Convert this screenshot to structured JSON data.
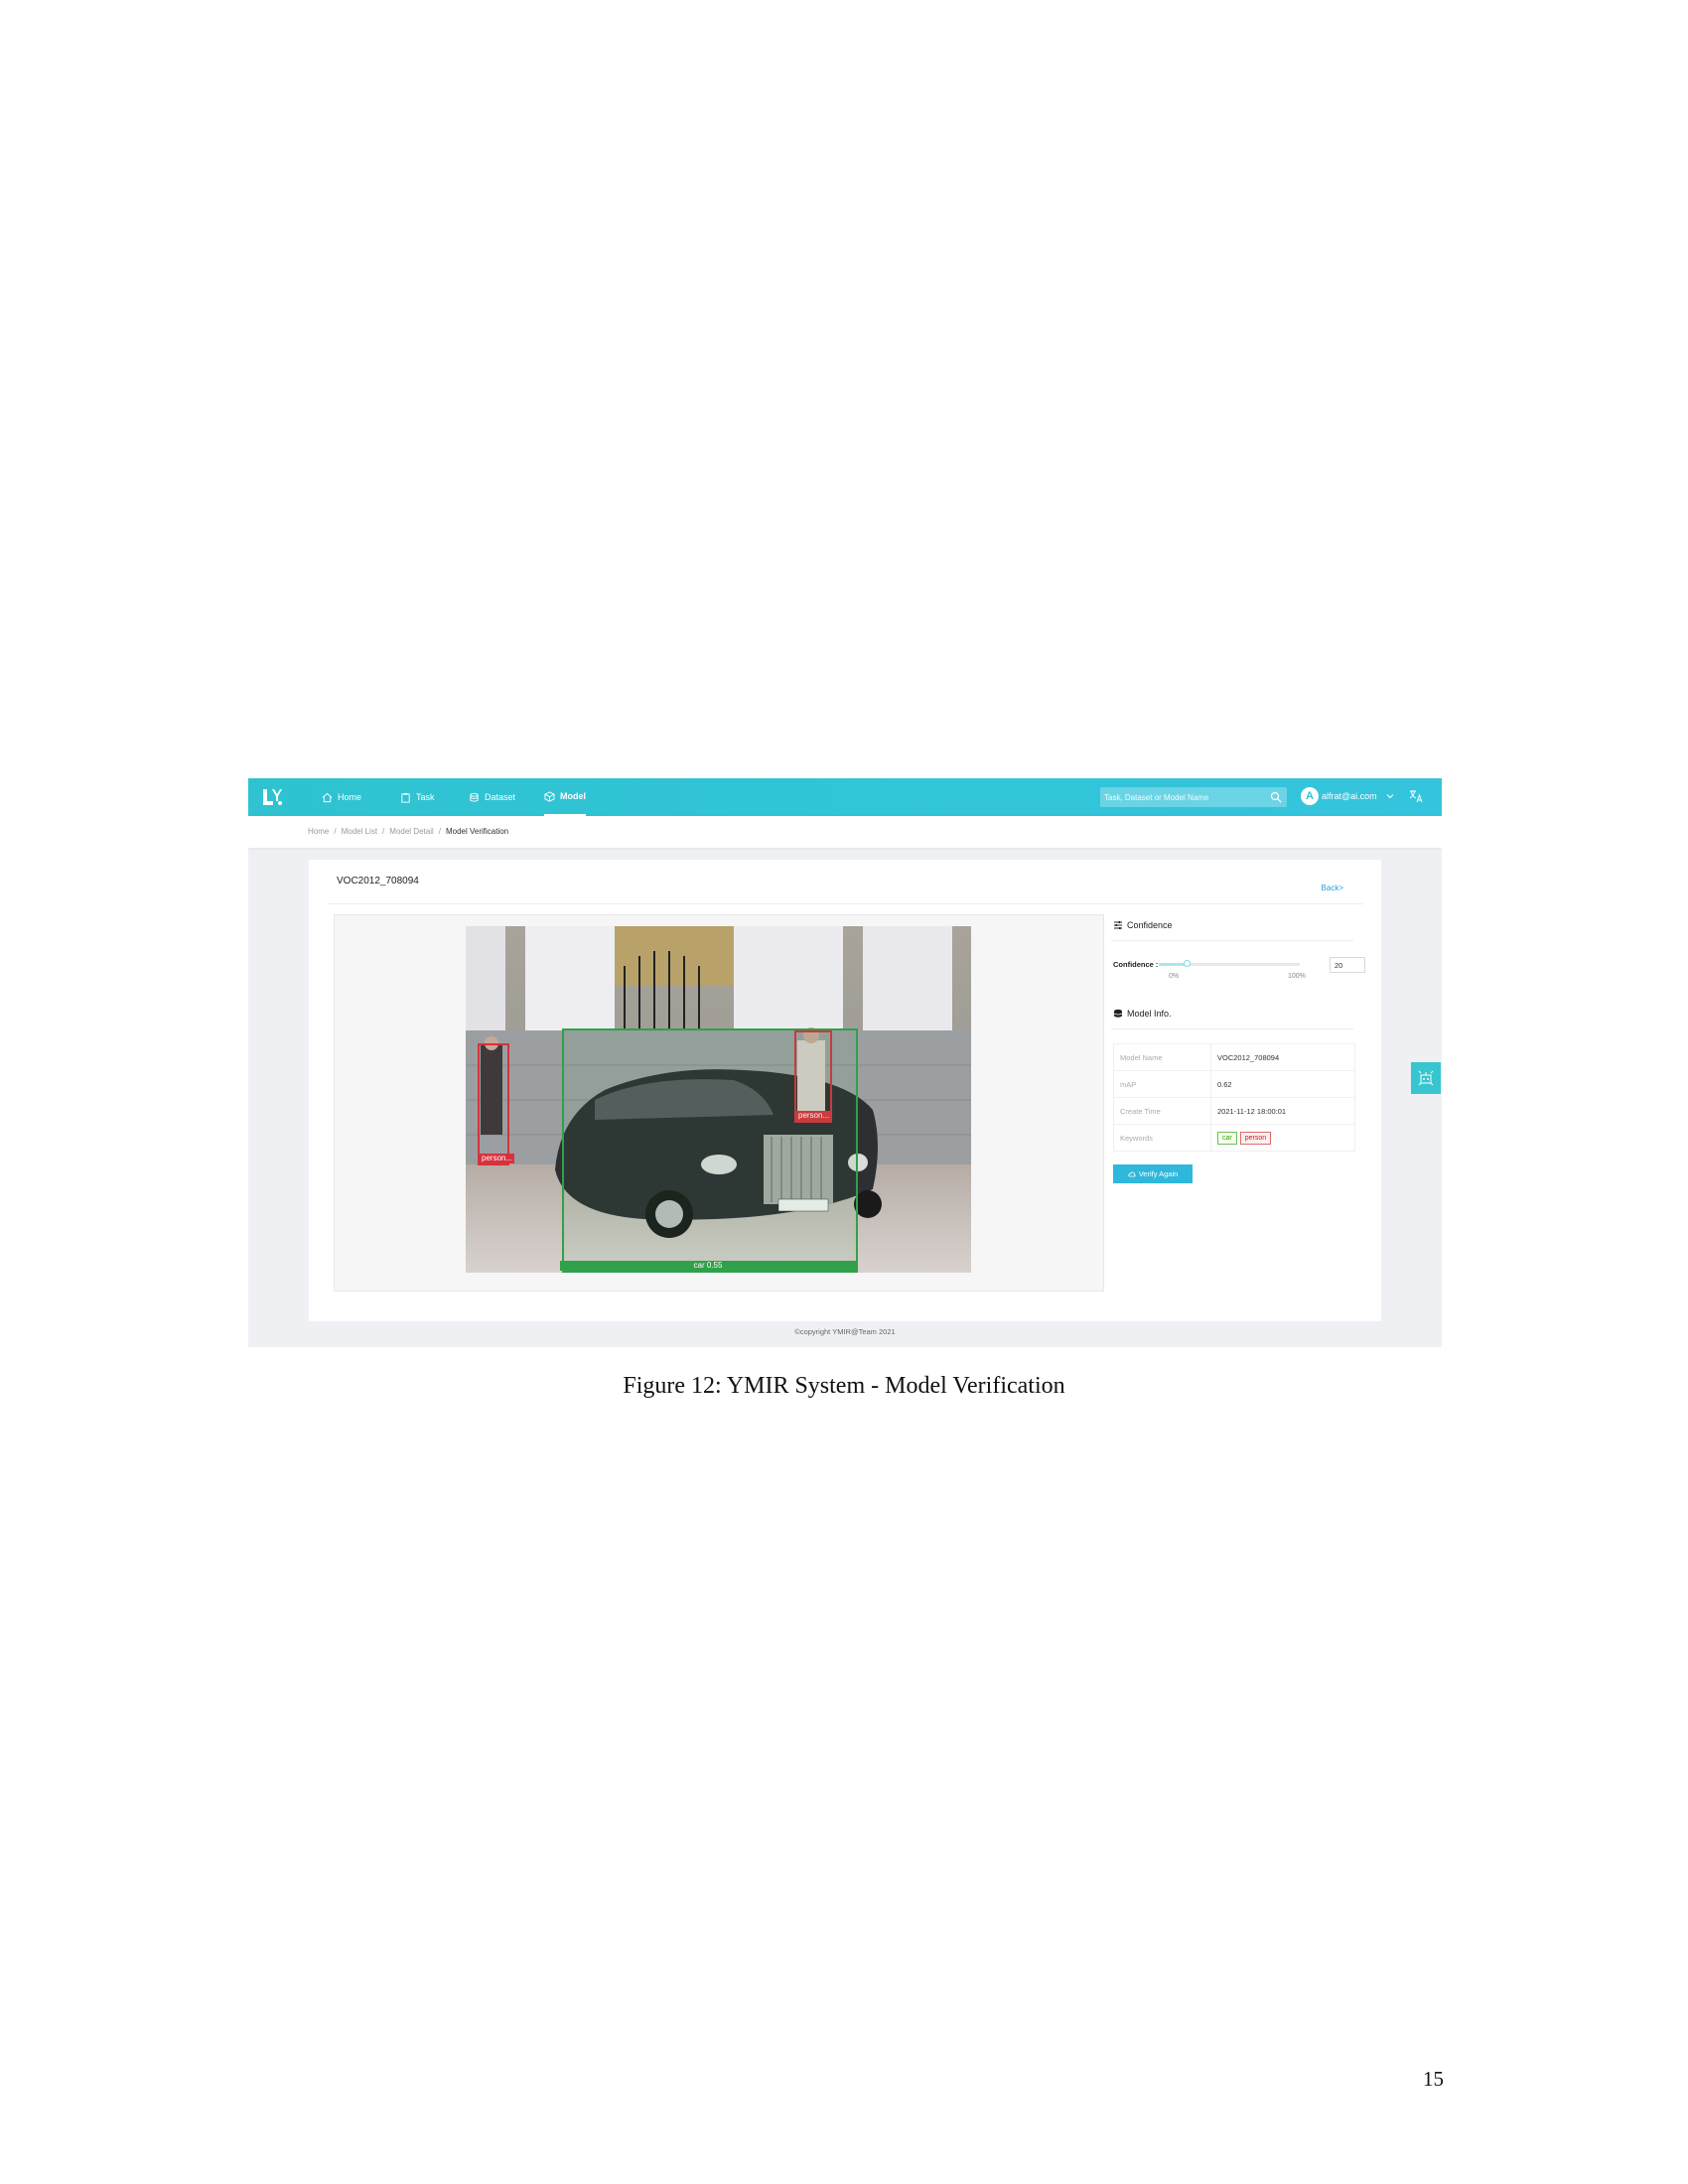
{
  "app": {
    "nav": {
      "items": [
        "Home",
        "Task",
        "Dataset",
        "Model"
      ],
      "active": "Model"
    },
    "search": {
      "placeholder": "Task, Dataset or Model Name"
    },
    "user": {
      "avatar_letter": "A",
      "email": "alfrat@ai.com"
    },
    "breadcrumb": [
      "Home",
      "Model List",
      "Model Detail",
      "Model Verification"
    ],
    "title": "VOC2012_708094",
    "back": "Back>",
    "detections": [
      {
        "label": "person...",
        "color": "#d6323c"
      },
      {
        "label": "person...",
        "color": "#d6323c"
      },
      {
        "label": "car 0.55",
        "color": "#31a04a"
      }
    ],
    "confidence": {
      "heading": "Confidence",
      "label": "Confidence :",
      "value": "20",
      "fraction": 0.2,
      "min_label": "0%",
      "max_label": "100%"
    },
    "model_info": {
      "heading": "Model Info.",
      "rows": [
        {
          "key": "Model Name",
          "value": "VOC2012_708094"
        },
        {
          "key": "mAP",
          "value": "0.62"
        },
        {
          "key": "Create Time",
          "value": "2021-11-12 18:00:01"
        }
      ],
      "keywords_key": "Keywords",
      "keywords": [
        "car",
        "person"
      ]
    },
    "verify_button": "Verify Again",
    "footer": "©copyright YMIR@Team 2021",
    "colors": {
      "nav": "#2fc3d1",
      "person_box": "#d6323c",
      "car_box": "#31a04a",
      "button": "#2fb8dc"
    }
  },
  "figure_caption": "Figure 12: YMIR System - Model Verification",
  "page_number": "15"
}
